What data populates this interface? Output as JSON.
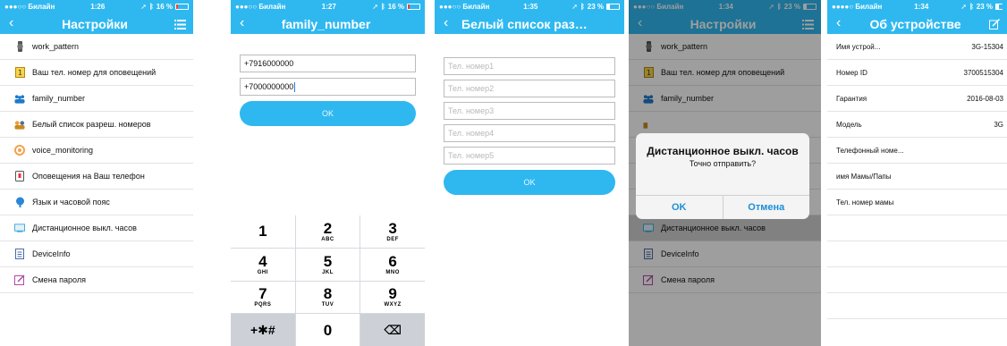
{
  "screens": [
    {
      "status": {
        "carrier": "●●●○○ Билайн",
        "time": "1:26",
        "battery": "16 %"
      },
      "title": "Настройки",
      "menu": [
        {
          "label": "work_pattern",
          "icon": "watch-icon"
        },
        {
          "label": "Ваш тел. номер для оповещений",
          "icon": "phone-number-icon"
        },
        {
          "label": "family_number",
          "icon": "family-icon"
        },
        {
          "label": "Белый список разреш. номеров",
          "icon": "whitelist-icon"
        },
        {
          "label": "voice_monitoring",
          "icon": "microphone-icon"
        },
        {
          "label": "Оповещения на Ваш телефон",
          "icon": "alert-phone-icon"
        },
        {
          "label": "Язык и часовой пояс",
          "icon": "globe-icon"
        },
        {
          "label": "Дистанционное выкл. часов",
          "icon": "power-off-icon"
        },
        {
          "label": "DeviceInfo",
          "icon": "document-icon"
        },
        {
          "label": "Смена пароля",
          "icon": "edit-icon"
        }
      ]
    },
    {
      "status": {
        "carrier": "●●●○○ Билайн",
        "time": "1:27",
        "battery": "16 %"
      },
      "title": "family_number",
      "fields": [
        "+7916000000",
        "+7000000000"
      ],
      "ok": "OK",
      "keypad": [
        {
          "digit": "1",
          "letters": ""
        },
        {
          "digit": "2",
          "letters": "ABC"
        },
        {
          "digit": "3",
          "letters": "DEF"
        },
        {
          "digit": "4",
          "letters": "GHI"
        },
        {
          "digit": "5",
          "letters": "JKL"
        },
        {
          "digit": "6",
          "letters": "MNO"
        },
        {
          "digit": "7",
          "letters": "PQRS"
        },
        {
          "digit": "8",
          "letters": "TUV"
        },
        {
          "digit": "9",
          "letters": "WXYZ"
        },
        {
          "digit": "+✱#",
          "letters": ""
        },
        {
          "digit": "0",
          "letters": ""
        },
        {
          "digit": "⌫",
          "letters": ""
        }
      ]
    },
    {
      "status": {
        "carrier": "●●●○○ Билайн",
        "time": "1:35",
        "battery": "23 %"
      },
      "title": "Белый список разре...",
      "placeholders": [
        "Тел. номер1",
        "Тел. номер2",
        "Тел. номер3",
        "Тел. номер4",
        "Тел. номер5"
      ],
      "ok": "OK"
    },
    {
      "status": {
        "carrier": "●●●○○ Билайн",
        "time": "1:34",
        "battery": "23 %"
      },
      "title": "Настройки",
      "menu_visible": [
        {
          "label": "work_pattern",
          "icon": "watch-icon"
        },
        {
          "label": "Ваш тел. номер для оповещений",
          "icon": "phone-number-icon"
        },
        {
          "label": "family_number",
          "icon": "family-icon"
        }
      ],
      "menu_lower": [
        {
          "label": "Дистанционное выкл. часов",
          "icon": "power-off-icon",
          "highlighted": true
        },
        {
          "label": "DeviceInfo",
          "icon": "document-icon"
        },
        {
          "label": "Смена пароля",
          "icon": "edit-icon"
        }
      ],
      "dialog": {
        "title": "Дистанционное выкл. часов",
        "message": "Точно отправить?",
        "ok": "OK",
        "cancel": "Отмена"
      }
    },
    {
      "status": {
        "carrier": "●●●●○ Билайн",
        "time": "1:34",
        "battery": "23 %"
      },
      "title": "Об устройстве",
      "rows": [
        {
          "label": "Имя устрой...",
          "value": "3G-15304"
        },
        {
          "label": "Номер ID",
          "value": "3700515304"
        },
        {
          "label": "Гарантия",
          "value": "2016-08-03"
        },
        {
          "label": "Модель",
          "value": "3G"
        },
        {
          "label": "Телефонный номе...",
          "value": ""
        },
        {
          "label": "имя Мамы/Папы",
          "value": ""
        },
        {
          "label": "Тел. номер мамы",
          "value": ""
        }
      ]
    }
  ],
  "colors": {
    "accent": "#2fb8f0",
    "dialog_button": "#1a8fd8"
  }
}
